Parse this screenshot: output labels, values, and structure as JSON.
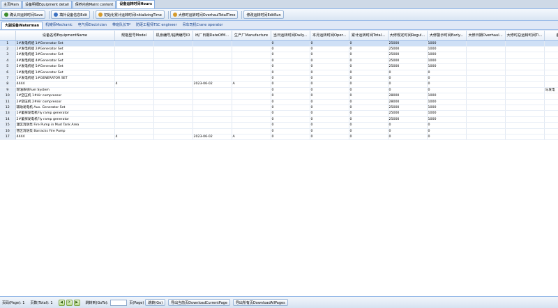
{
  "top_tabs": [
    {
      "label": "主页Main"
    },
    {
      "label": "设备明细Equipment detail"
    },
    {
      "label": "保养内容Maint content"
    },
    {
      "label": "设备运转时间Hours"
    }
  ],
  "toolbar": {
    "buttons": [
      {
        "label": "确认日运转时间Save",
        "icon_color": "#3b8c2a"
      },
      {
        "label": "填补设备信息Edit",
        "icon_color": "#3a70c0"
      },
      {
        "label": "初始化累计运转时间InitializingTime",
        "icon_color": "#d59a2a"
      },
      {
        "label": "大修时运转时间OverhaulTotalTime",
        "icon_color": "#d59a2a"
      },
      {
        "label": "修改运转时间EditRun",
        "icon_color": ""
      }
    ]
  },
  "sub_tabs": [
    {
      "label": "大副设备Waterman"
    },
    {
      "label": "机械师Mechanic"
    },
    {
      "label": "电气师Electrician"
    },
    {
      "label": "带班队长TP"
    },
    {
      "label": "防砸工程师TSC engineer"
    },
    {
      "label": "吊车司机Crane operator"
    }
  ],
  "grid": {
    "columns": [
      "设备名称EquipmentName",
      "规格型号Model",
      "机身编号/铭牌编号ID",
      "出厂日期DateOfM...",
      "生产厂Manufacture",
      "当日运转时间Daily...",
      "本月运转时间Oper...",
      "累计运转时间Total...",
      "大修规定时间Regul...",
      "大修警示时间Early...",
      "大修日期Overhaul...",
      "大修时总运转时间Ti...",
      "备"
    ],
    "rows": [
      {
        "n": "1",
        "c": [
          "1#发电机组 1#Generator Set",
          "",
          "",
          "",
          "",
          "0",
          "0",
          "0",
          "25000",
          "1000",
          "",
          "",
          ""
        ]
      },
      {
        "n": "2",
        "c": [
          "2#发电机组 2#Generator Set",
          "",
          "",
          "",
          "",
          "0",
          "0",
          "0",
          "25000",
          "1000",
          "",
          "",
          ""
        ]
      },
      {
        "n": "3",
        "c": [
          "3#发电机组 3#Generator Set",
          "",
          "",
          "",
          "",
          "0",
          "0",
          "0",
          "25000",
          "1000",
          "",
          "",
          ""
        ]
      },
      {
        "n": "4",
        "c": [
          "4#发电机组 4#Generator Set",
          "",
          "",
          "",
          "",
          "0",
          "0",
          "0",
          "25000",
          "1000",
          "",
          "",
          ""
        ]
      },
      {
        "n": "5",
        "c": [
          "5#发电机组 5#Generator Set",
          "",
          "",
          "",
          "",
          "0",
          "0",
          "0",
          "25000",
          "1000",
          "",
          "",
          ""
        ]
      },
      {
        "n": "6",
        "c": [
          "1#发电机组 1#Generator Set",
          "",
          "",
          "",
          "",
          "0",
          "0",
          "0",
          "0",
          "0",
          "",
          "",
          ""
        ]
      },
      {
        "n": "7",
        "c": [
          "1#发电机组 1#GENERATOR SET",
          "",
          "",
          "",
          "",
          "0",
          "0",
          "0",
          "0",
          "0",
          "",
          "",
          ""
        ]
      },
      {
        "n": "8",
        "c": [
          "4444",
          "4",
          "",
          "2023-06-02",
          "A",
          "0",
          "0",
          "0",
          "0",
          "0",
          "",
          "",
          ""
        ]
      },
      {
        "n": "9",
        "c": [
          "燃油系统Fuel System",
          "",
          "",
          "",
          "",
          "0",
          "0",
          "0",
          "0",
          "0",
          "",
          "",
          "与发电"
        ]
      },
      {
        "n": "10",
        "c": [
          "1#空压机 1#Air compressor",
          "",
          "",
          "",
          "",
          "0",
          "0",
          "0",
          "28000",
          "1000",
          "",
          "",
          ""
        ]
      },
      {
        "n": "11",
        "c": [
          "2#空压机 2#Air compressor",
          "",
          "",
          "",
          "",
          "0",
          "0",
          "0",
          "28000",
          "1000",
          "",
          "",
          ""
        ]
      },
      {
        "n": "12",
        "c": [
          "辅助发电机 Aux. Generator Set",
          "",
          "",
          "",
          "",
          "0",
          "0",
          "0",
          "25000",
          "1000",
          "",
          "",
          ""
        ]
      },
      {
        "n": "13",
        "c": [
          "1#蓄探发电机Fly ramp generator",
          "",
          "",
          "",
          "",
          "0",
          "0",
          "0",
          "25000",
          "1000",
          "",
          "",
          ""
        ]
      },
      {
        "n": "14",
        "c": [
          "2#蓄探发电机Fly ramp generator",
          "",
          "",
          "",
          "",
          "0",
          "0",
          "0",
          "25000",
          "1000",
          "",
          "",
          ""
        ]
      },
      {
        "n": "15",
        "c": [
          "灌区消防泵 Fire Pump in  Mud Tank Area",
          "",
          "",
          "",
          "",
          "0",
          "0",
          "0",
          "0",
          "0",
          "",
          "",
          ""
        ]
      },
      {
        "n": "16",
        "c": [
          "营区消防泵 Barracks Fire Pump",
          "",
          "",
          "",
          "",
          "0",
          "0",
          "0",
          "0",
          "0",
          "",
          "",
          ""
        ]
      },
      {
        "n": "17",
        "c": [
          "4444",
          "4",
          "",
          "2023-06-02",
          "A",
          "0",
          "0",
          "0",
          "0",
          "0",
          "",
          "",
          ""
        ]
      }
    ]
  },
  "status": {
    "page_label": "页码(Page): 1",
    "total_label": "页数(Total): 1",
    "goto_label": "跳转到(GoTo):",
    "goto_value": "",
    "page_suffix": "页(Page)",
    "go_button": "跳转(Go)",
    "export_current": "导出当前页DownloadCurrentPage",
    "export_all": "导出所有页DownloadAllPages"
  }
}
